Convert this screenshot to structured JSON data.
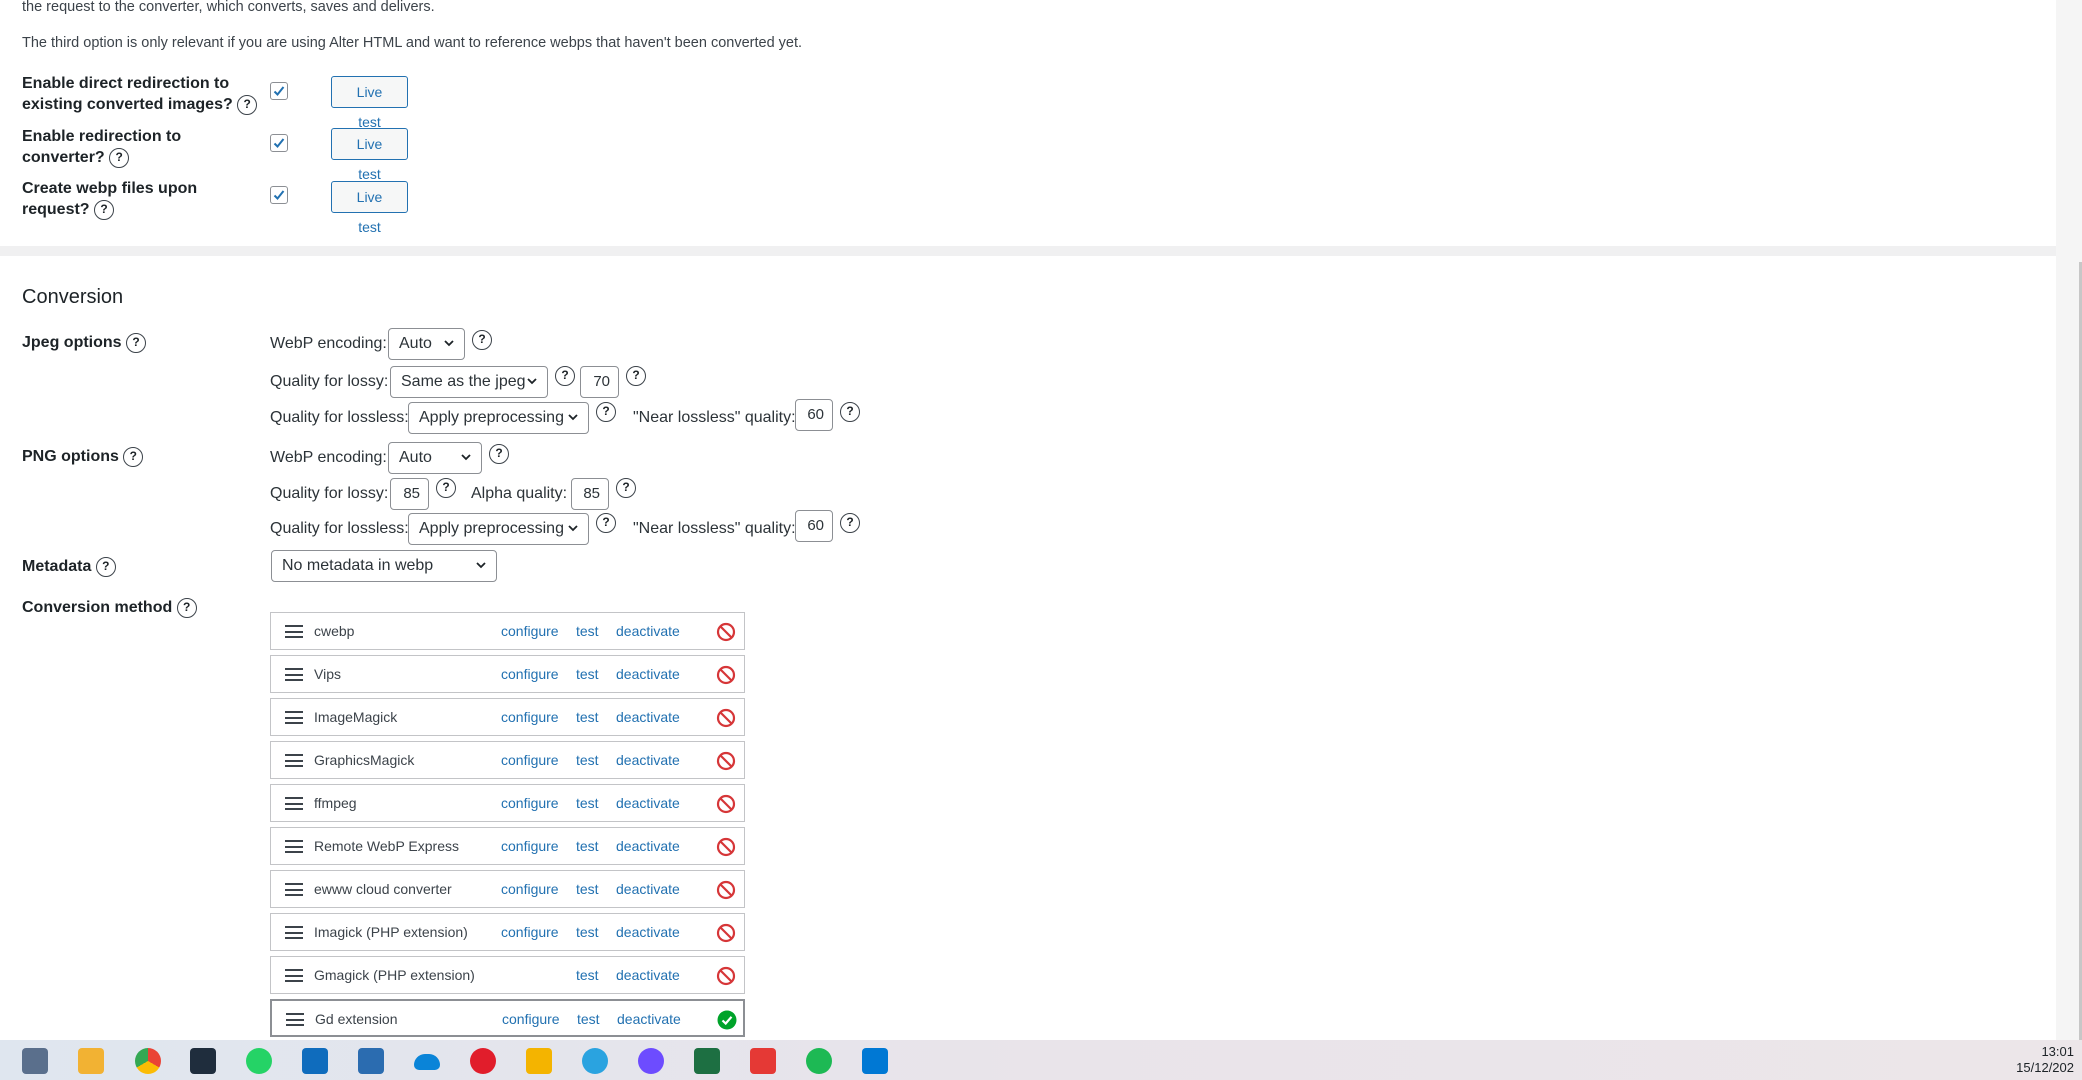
{
  "intro": {
    "line1": "the request to the converter, which converts, saves and delivers.",
    "line2": "The third option is only relevant if you are using Alter HTML and want to reference webps that haven't been converted yet."
  },
  "redirect_options": [
    {
      "label_line1": "Enable direct redirection to",
      "label_line2": "existing converted images?",
      "checked": true,
      "button": "Live test"
    },
    {
      "label_line1": "Enable redirection to",
      "label_line2": "converter?",
      "checked": true,
      "button": "Live test"
    },
    {
      "label_line1": "Create webp files upon",
      "label_line2": "request?",
      "checked": true,
      "button": "Live test"
    }
  ],
  "help_glyph": "?",
  "conversion": {
    "heading": "Conversion",
    "jpeg": {
      "label": "Jpeg options",
      "encoding_label": "WebP encoding:",
      "encoding_value": "Auto",
      "lossy_label": "Quality for lossy:",
      "lossy_value": "Same as the jpeg",
      "lossy_number": "70",
      "lossless_label": "Quality for lossless:",
      "lossless_value": "Apply preprocessing",
      "near_label": "\"Near lossless\" quality:",
      "near_value": "60"
    },
    "png": {
      "label": "PNG options",
      "encoding_label": "WebP encoding:",
      "encoding_value": "Auto",
      "lossy_label": "Quality for lossy:",
      "lossy_value": "85",
      "alpha_label": "Alpha quality:",
      "alpha_value": "85",
      "lossless_label": "Quality for lossless:",
      "lossless_value": "Apply preprocessing",
      "near_label": "\"Near lossless\" quality:",
      "near_value": "60"
    },
    "metadata": {
      "label": "Metadata",
      "value": "No metadata in webp"
    },
    "method_label": "Conversion method",
    "link_configure": "configure",
    "link_test": "test",
    "link_deactivate": "deactivate",
    "converters": [
      {
        "name": "cwebp",
        "configure": true,
        "status": "not-operational"
      },
      {
        "name": "Vips",
        "configure": true,
        "status": "not-operational"
      },
      {
        "name": "ImageMagick",
        "configure": true,
        "status": "not-operational"
      },
      {
        "name": "GraphicsMagick",
        "configure": true,
        "status": "not-operational"
      },
      {
        "name": "ffmpeg",
        "configure": true,
        "status": "not-operational"
      },
      {
        "name": "Remote WebP Express",
        "configure": true,
        "status": "not-operational"
      },
      {
        "name": "ewww cloud converter",
        "configure": true,
        "status": "not-operational"
      },
      {
        "name": "Imagick (PHP extension)",
        "configure": true,
        "status": "not-operational"
      },
      {
        "name": "Gmagick (PHP extension)",
        "configure": false,
        "status": "not-operational"
      },
      {
        "name": "Gd extension",
        "configure": true,
        "status": "operational"
      }
    ]
  },
  "colors": {
    "link": "#2271b1",
    "error": "#d63638",
    "success": "#00a32a"
  },
  "taskbar": {
    "icons": [
      "calculator-icon",
      "file-explorer-icon",
      "chrome-icon",
      "terminal-icon",
      "whatsapp-icon",
      "outlook-icon",
      "photos-icon",
      "onedrive-icon",
      "gmail-icon",
      "google-drive-icon",
      "telegram-icon",
      "messenger-icon",
      "excel-icon",
      "anydesk-icon",
      "spotify-icon",
      "mail-icon"
    ],
    "time": "13:01",
    "date": "15/12/202"
  }
}
